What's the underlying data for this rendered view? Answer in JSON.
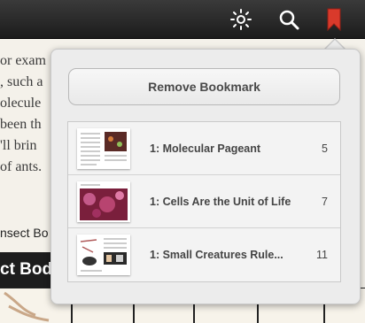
{
  "background_page": {
    "lines": [
      "or exam",
      ", such a",
      "olecule",
      "been th",
      "'ll brin",
      "of ants."
    ],
    "caption": "nsect Bo",
    "banner": "ct Body"
  },
  "toolbar": {
    "icons": [
      "brightness-icon",
      "search-icon",
      "bookmark-icon"
    ],
    "bookmark_color": "#d93a2b"
  },
  "popover": {
    "remove_label": "Remove Bookmark",
    "bookmarks": [
      {
        "title": "1: Molecular Pageant",
        "page": "5"
      },
      {
        "title": "1: Cells Are the Unit of Life",
        "page": "7"
      },
      {
        "title": "1: Small Creatures Rule...",
        "page": "11"
      }
    ]
  }
}
